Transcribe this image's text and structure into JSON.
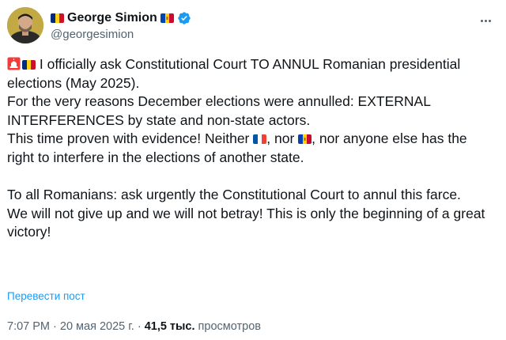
{
  "author": {
    "name": "George Simion",
    "handle": "@georgesimion"
  },
  "tweet": {
    "para1_text": " I officially ask Constitutional Court TO ANNUL Romanian presidential elections (May 2025).",
    "para2_text": "For the very reasons December elections were annulled: EXTERNAL INTERFERENCES by state and non-state actors.",
    "para3_a": "This time proven with evidence! Neither ",
    "para3_b": ", nor ",
    "para3_c": ", nor anyone else has the right to interfere in the elections of another state.",
    "para4_text": "To all Romanians: ask urgently the Constitutional Court to annul this farce.",
    "para5_text": "We will not give up and we will not betray! This is only the beginning of a great victory!"
  },
  "translate_label": "Перевести пост",
  "meta": {
    "time": "7:07 PM · 20 мая 2025 г. · ",
    "views_count": "41,5 тыс.",
    "views_label": " просмотров"
  },
  "icons": {
    "verified": "verified-badge-icon",
    "more": "more-options-icon",
    "flag_ro": "romania-flag-icon",
    "flag_md": "moldova-flag-icon",
    "flag_fr": "france-flag-icon",
    "siren": "siren-icon"
  },
  "colors": {
    "link": "#1d9bf0",
    "secondary_text": "#536471",
    "primary_text": "#0f1419"
  }
}
